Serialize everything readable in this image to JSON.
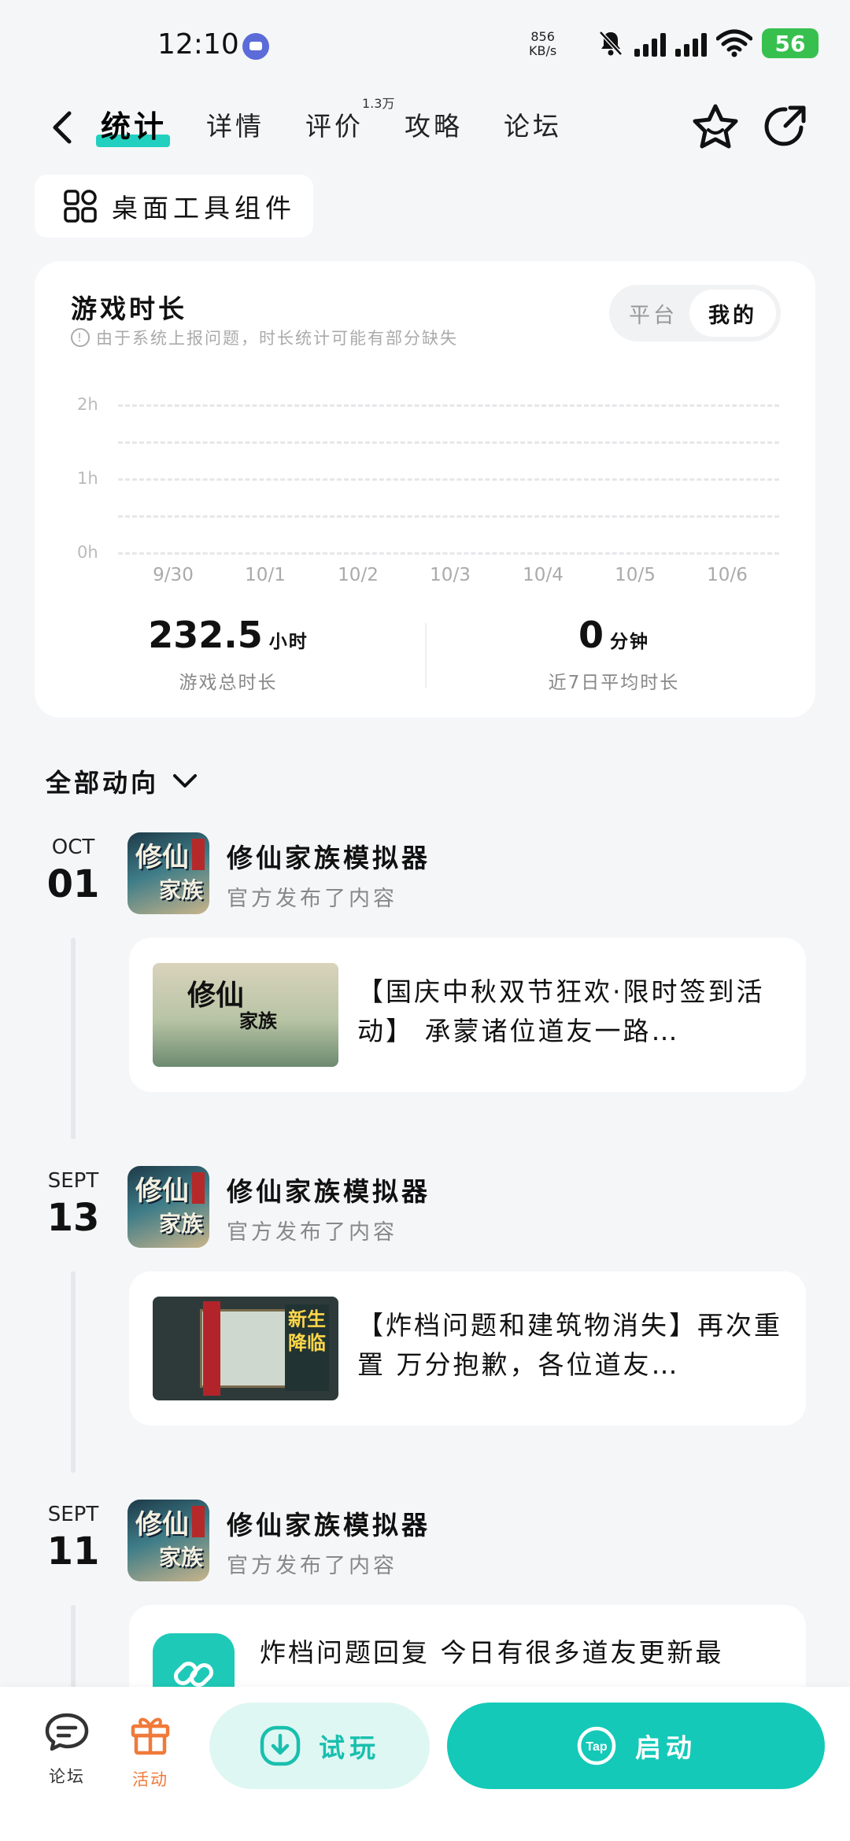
{
  "status_bar": {
    "time": "12:10",
    "net_speed_value": "856",
    "net_speed_unit": "KB/s",
    "battery": "56"
  },
  "nav": {
    "tabs": [
      {
        "label": "统计",
        "active": true
      },
      {
        "label": "详情",
        "active": false
      },
      {
        "label": "评价",
        "active": false,
        "badge": "1.3万"
      },
      {
        "label": "攻略",
        "active": false
      },
      {
        "label": "论坛",
        "active": false
      }
    ],
    "icons": [
      "back-icon",
      "star-icon",
      "share-icon"
    ]
  },
  "widget_button": {
    "label": "桌面工具组件",
    "icon": "grid-widget-icon"
  },
  "stats_card": {
    "title": "游戏时长",
    "note": "由于系统上报问题，时长统计可能有部分缺失",
    "segments": [
      "平台",
      "我的"
    ],
    "selected_segment": "我的",
    "y_labels": [
      "2h",
      "1h",
      "0h"
    ],
    "x_labels": [
      "9/30",
      "10/1",
      "10/2",
      "10/3",
      "10/4",
      "10/5",
      "10/6"
    ],
    "total_value": "232.5",
    "total_unit": "小时",
    "total_label": "游戏总时长",
    "avg_value": "0",
    "avg_unit": "分钟",
    "avg_label": "近7日平均时长"
  },
  "feed": {
    "title": "全部动向",
    "entries": [
      {
        "month": "OCT",
        "day": "01",
        "game_name": "修仙家族模拟器",
        "action": "官方发布了内容",
        "icon_text_1": "修仙",
        "icon_text_2": "家族",
        "thumb_text_1": "修仙",
        "thumb_text_2": "家族",
        "post_text": "【国庆中秋双节狂欢·限时签到活动】 承蒙诸位道友一路…"
      },
      {
        "month": "SEPT",
        "day": "13",
        "game_name": "修仙家族模拟器",
        "action": "官方发布了内容",
        "icon_text_1": "修仙",
        "icon_text_2": "家族",
        "thumb_text_1": "新生降临",
        "post_text": "【炸档问题和建筑物消失】再次重置 万分抱歉，各位道友…"
      },
      {
        "month": "SEPT",
        "day": "11",
        "game_name": "修仙家族模拟器",
        "action": "官方发布了内容",
        "icon_text_1": "修仙",
        "icon_text_2": "家族",
        "post_text": "炸档问题回复 今日有很多道友更新最"
      }
    ]
  },
  "bottom_bar": {
    "forum_label": "论坛",
    "activity_label": "活动",
    "try_label": "试玩",
    "start_label": "启动",
    "activity_color": "#f07a3a",
    "accent_color": "#14c9b8"
  }
}
